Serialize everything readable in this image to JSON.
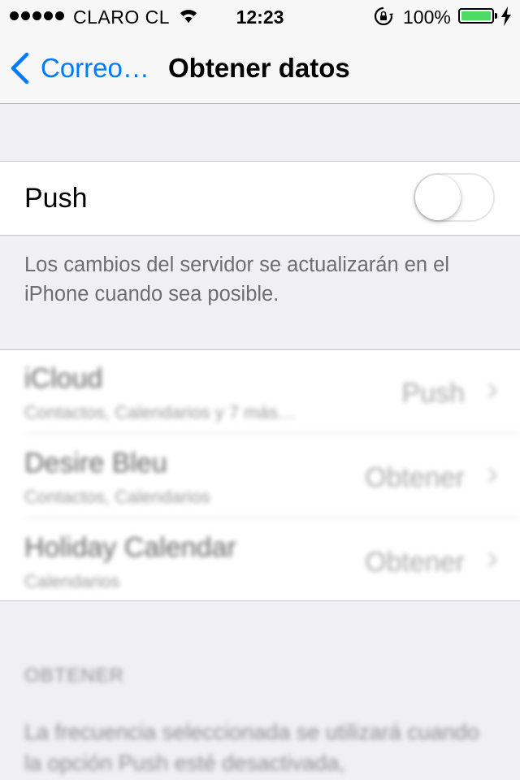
{
  "status_bar": {
    "carrier": "CLARO CL",
    "time": "12:23",
    "battery_percent": "100%",
    "battery_color": "#4cd964",
    "icons": [
      "signal-dots-icon",
      "wifi-icon",
      "rotation-lock-icon",
      "battery-icon",
      "charging-bolt-icon"
    ]
  },
  "nav": {
    "back_label": "Correo…",
    "title": "Obtener datos",
    "accent_color": "#007aff"
  },
  "push": {
    "label": "Push",
    "enabled": false,
    "footer": "Los cambios del servidor se actualizarán en el iPhone cuando sea posible."
  },
  "accounts": [
    {
      "name": "iCloud",
      "detail": "Contactos, Calendarios y 7 más…",
      "value": "Push"
    },
    {
      "name": "Desire Bleu",
      "detail": "Contactos, Calendarios",
      "value": "Obtener"
    },
    {
      "name": "Holiday Calendar",
      "detail": "Calendarios",
      "value": "Obtener"
    }
  ],
  "fetch": {
    "header": "OBTENER",
    "note": "La frecuencia seleccionada se utilizará cuando la opción Push esté desactivada,"
  }
}
